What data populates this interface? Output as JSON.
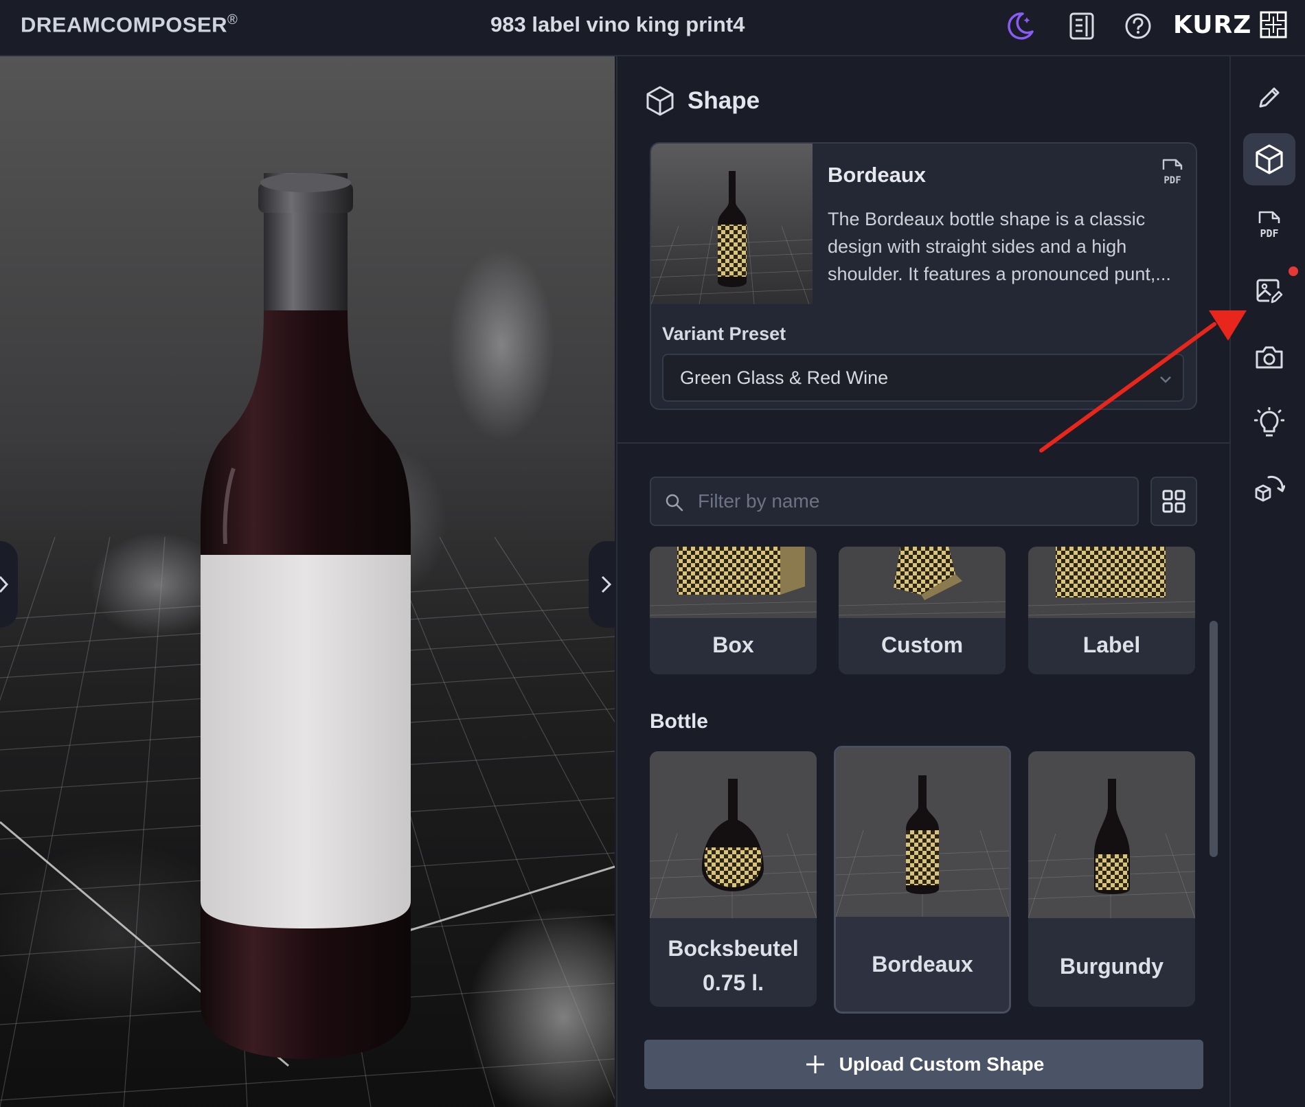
{
  "app": {
    "brand": "DREAMCOMPOSER",
    "brand_mark": "®",
    "document_title": "983 label vino king print4",
    "logo_text": "KURZ"
  },
  "header_icons": [
    "theme-moon-icon",
    "docs-icon",
    "help-icon"
  ],
  "panel": {
    "title": "Shape",
    "selected": {
      "name": "Bordeaux",
      "description": "The Bordeaux bottle shape is a classic design with straight sides and a high shoulder. It features a pronounced punt,...",
      "pdf_label": "PDF",
      "variant_label": "Variant Preset",
      "variant_value": "Green Glass & Red Wine"
    },
    "filter_placeholder": "Filter by name",
    "generic_shapes": [
      {
        "label": "Box"
      },
      {
        "label": "Custom"
      },
      {
        "label": "Label"
      }
    ],
    "bottle_section_title": "Bottle",
    "bottle_shapes": [
      {
        "label_line1": "Bocksbeutel",
        "label_line2": "0.75 l."
      },
      {
        "label": "Bordeaux",
        "selected": true
      },
      {
        "label": "Burgundy"
      }
    ],
    "upload_label": "Upload Custom Shape"
  },
  "rail": {
    "items": [
      "edit-icon",
      "shape-cube-icon",
      "pdf-icon",
      "image-edit-icon",
      "camera-icon",
      "lighting-bulb-icon",
      "3d-rotate-icon"
    ],
    "active": "shape-cube-icon",
    "pdf_label": "PDF"
  },
  "viewport_tools": [
    "undo-icon",
    "dropdown-icon",
    "snapshot-camera-icon",
    "share-icon",
    "fullscreen-icon",
    "magic-wand-icon",
    "preview-eye-icon"
  ],
  "colors": {
    "background": "#1a1d27",
    "card": "#242835",
    "accent_moon": "#8a5cf6",
    "upload_button": "#4b5466",
    "annotation_arrow": "#e8261c",
    "notification_dot": "#e53935"
  }
}
